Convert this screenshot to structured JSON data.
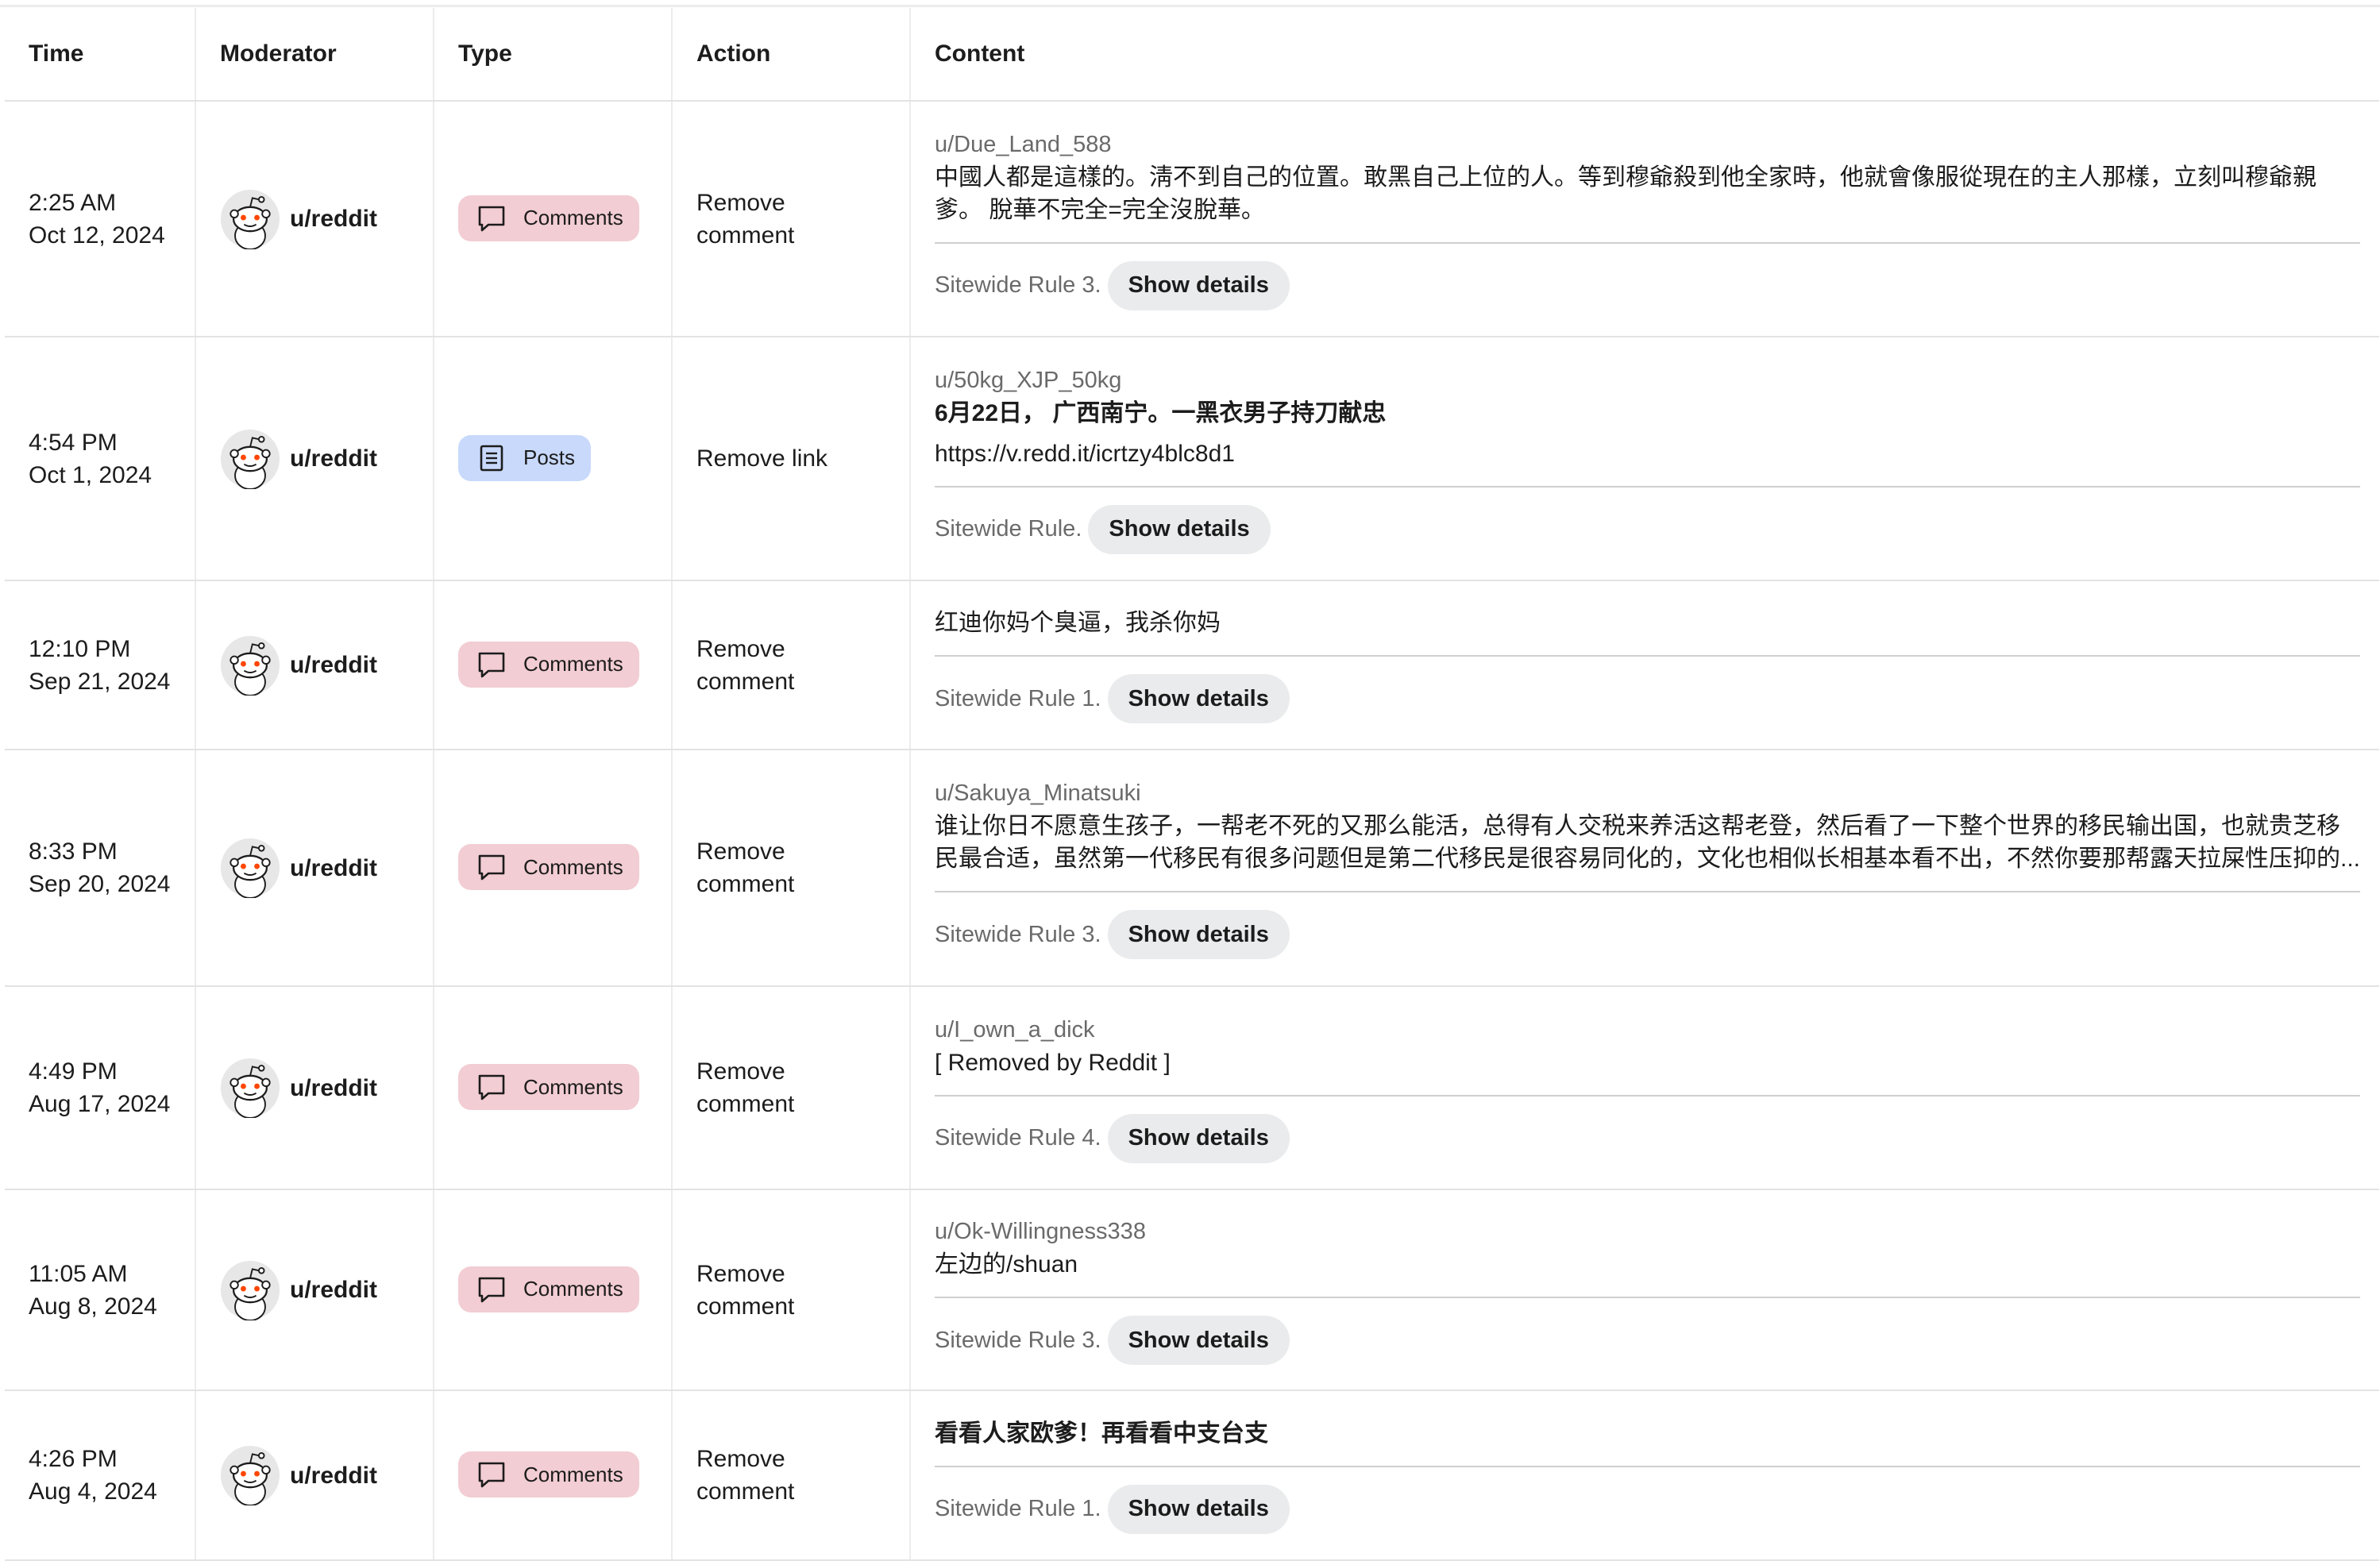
{
  "headers": {
    "time": "Time",
    "moderator": "Moderator",
    "type": "Type",
    "action": "Action",
    "content": "Content"
  },
  "show_details_label": "Show details",
  "colors": {
    "comments_badge": "#f2cdd3",
    "posts_badge": "#c8d9fb",
    "button": "#e9ebec"
  },
  "rows": [
    {
      "time": "2:25 AM",
      "date": "Oct 12, 2024",
      "moderator": "u/reddit",
      "type": "Comments",
      "type_icon": "comment-icon",
      "action": "Remove comment",
      "author": "u/Due_Land_588",
      "text": "中國人都是這樣的。淸不到自己的位置。敢黑自己上位的人。等到穆爺殺到他全家時，他就會像服從現在的主人那樣，立刻叫穆爺親爹。 脫華不完全=完全沒脫華。",
      "rule": "Sitewide Rule 3."
    },
    {
      "time": "4:54 PM",
      "date": "Oct 1, 2024",
      "moderator": "u/reddit",
      "type": "Posts",
      "type_icon": "post-icon",
      "action": "Remove link",
      "author": "u/50kg_XJP_50kg",
      "text": "6月22日， 广西南宁。一黑衣男子持刀献忠",
      "link": "https://v.redd.it/icrtzy4blc8d1",
      "rule": "Sitewide Rule."
    },
    {
      "time": "12:10 PM",
      "date": "Sep 21, 2024",
      "moderator": "u/reddit",
      "type": "Comments",
      "type_icon": "comment-icon",
      "action": "Remove comment",
      "text": "红迪你妈个臭逼，我杀你妈",
      "rule": "Sitewide Rule 1."
    },
    {
      "time": "8:33 PM",
      "date": "Sep 20, 2024",
      "moderator": "u/reddit",
      "type": "Comments",
      "type_icon": "comment-icon",
      "action": "Remove comment",
      "author": "u/Sakuya_Minatsuki",
      "text": "谁让你日不愿意生孩子，一帮老不死的又那么能活，总得有人交税来养活这帮老登，然后看了一下整个世界的移民输出国，也就贵芝移民最合适，虽然第一代移民有很多问题但是第二代移民是很容易同化的，文化也相似长相基本看不出，不然你要那帮露天拉屎性压抑的...",
      "rule": "Sitewide Rule 3."
    },
    {
      "time": "4:49 PM",
      "date": "Aug 17, 2024",
      "moderator": "u/reddit",
      "type": "Comments",
      "type_icon": "comment-icon",
      "action": "Remove comment",
      "author": "u/I_own_a_dick",
      "text": "[ Removed by Reddit ]",
      "rule": "Sitewide Rule 4."
    },
    {
      "time": "11:05 AM",
      "date": "Aug 8, 2024",
      "moderator": "u/reddit",
      "type": "Comments",
      "type_icon": "comment-icon",
      "action": "Remove comment",
      "author": "u/Ok-Willingness338",
      "text": "左边的/shuan",
      "rule": "Sitewide Rule 3."
    },
    {
      "time": "4:26 PM",
      "date": "Aug 4, 2024",
      "moderator": "u/reddit",
      "type": "Comments",
      "type_icon": "comment-icon",
      "action": "Remove comment",
      "text": "看看人家欧爹！再看看中支台支",
      "rule": "Sitewide Rule 1."
    }
  ]
}
